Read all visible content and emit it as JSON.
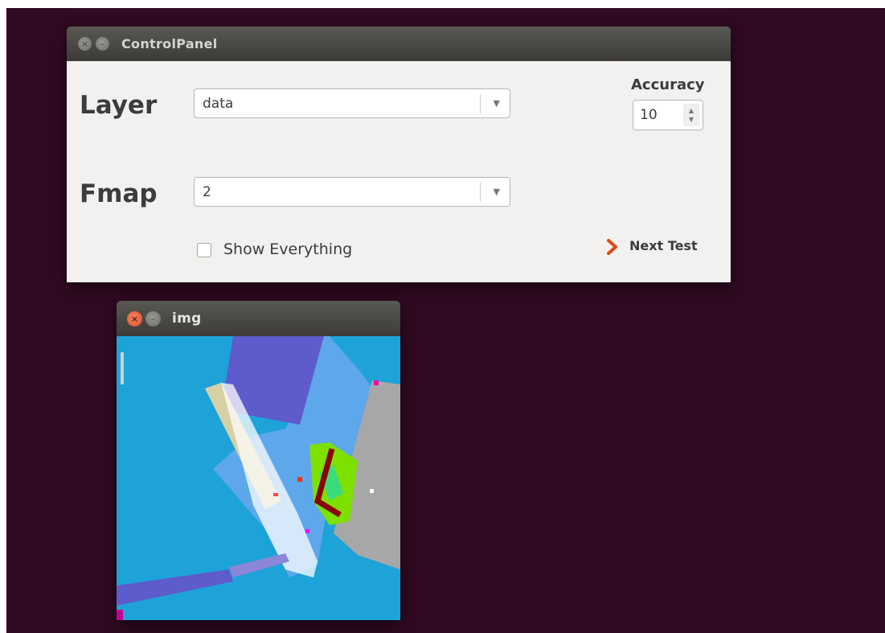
{
  "control_panel": {
    "title": "ControlPanel",
    "layer_label": "Layer",
    "layer_value": "data",
    "fmap_label": "Fmap",
    "fmap_value": "2",
    "accuracy_label": "Accuracy",
    "accuracy_value": "10",
    "show_everything_label": "Show Everything",
    "show_everything_checked": false,
    "next_test_label": "Next Test"
  },
  "img_window": {
    "title": "img"
  },
  "colors": {
    "desktop": "#2f0a22",
    "titlebar": "#3d3b37",
    "panel": "#f2f1f0",
    "close_active": "#e2572c",
    "next_arrow": "#dd4814",
    "segment_bg": "#1ea3d9",
    "segment_light_blue": "#5da7ea",
    "segment_purple": "#5e5bcd",
    "segment_gray": "#a7a7a7",
    "segment_beige": "#d8d0a5",
    "segment_lime": "#7ee000",
    "segment_darkred": "#8b0000"
  },
  "icons": [
    "close-icon",
    "minimize-icon",
    "dropdown-arrow-icon",
    "spin-up-icon",
    "spin-down-icon",
    "chevron-right-icon"
  ]
}
